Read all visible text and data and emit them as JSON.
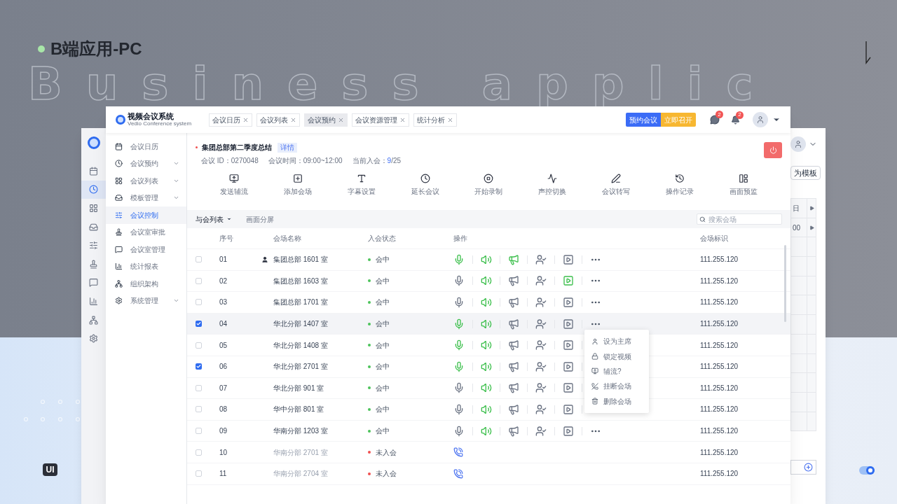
{
  "backdrop": {
    "heading": "B端应用-PC",
    "watermark": "Business applic",
    "badge": "UI"
  },
  "back_window": {
    "button": "为模板",
    "rail": [
      {
        "selected": false
      },
      {
        "selected": true
      },
      {
        "selected": false
      },
      {
        "selected": false
      },
      {
        "selected": false
      },
      {
        "selected": false
      },
      {
        "selected": false
      },
      {
        "selected": false
      },
      {
        "selected": false
      },
      {
        "selected": false
      }
    ],
    "cells": [
      "日",
      "00"
    ]
  },
  "app": {
    "title": "视频会议系统",
    "subtitle": "Vedio Conference system",
    "tabs": [
      {
        "label": "会议日历",
        "selected": false
      },
      {
        "label": "会议列表",
        "selected": false
      },
      {
        "label": "会议预约",
        "selected": true
      },
      {
        "label": "会议资源管理",
        "selected": false
      },
      {
        "label": "统计分析",
        "selected": false
      }
    ],
    "buttons": [
      "预约会议",
      "立即召开"
    ],
    "badges": [
      "2",
      "2"
    ],
    "sidebar": [
      {
        "label": "会议日历",
        "selected": false,
        "expandable": false
      },
      {
        "label": "会议预约",
        "selected": false,
        "expandable": true
      },
      {
        "label": "会议列表",
        "selected": false,
        "expandable": true
      },
      {
        "label": "模板管理",
        "selected": false,
        "expandable": true
      },
      {
        "label": "会议控制",
        "selected": true,
        "expandable": false
      },
      {
        "label": "会议室审批",
        "selected": false,
        "expandable": false
      },
      {
        "label": "会议室管理",
        "selected": false,
        "expandable": false
      },
      {
        "label": "统计报表",
        "selected": false,
        "expandable": false
      },
      {
        "label": "组织架构",
        "selected": false,
        "expandable": false
      },
      {
        "label": "系统管理",
        "selected": false,
        "expandable": true
      }
    ],
    "meeting": {
      "title": "集团总部第二季度总结",
      "tag": "详情",
      "id_label": "会议 ID：",
      "id": "0270048",
      "time_label": "会议时间：",
      "time": "09:00~12:00",
      "joined_label": "当前入会：",
      "joined": "9",
      "total": "/25"
    },
    "toolbar": [
      "发送辅流",
      "添加会场",
      "字幕设置",
      "延长会议",
      "开始录制",
      "声控切换",
      "会议转写",
      "操作记录",
      "画面预监"
    ],
    "views": [
      {
        "label": "与会列表",
        "selected": true
      },
      {
        "label": "画面分屏",
        "selected": false
      }
    ],
    "search": {
      "placeholder": "搜索会场"
    },
    "table": {
      "columns": [
        "序号",
        "会场名称",
        "入会状态",
        "操作",
        "会场标识"
      ],
      "rows": [
        {
          "checked": false,
          "selected": false,
          "index": "01",
          "more": true,
          "chair": true,
          "name": "集团总部 1601 室",
          "status": "会中",
          "kind": "joined",
          "mic_on": true,
          "speaker_on": true,
          "broadcast_on": true,
          "video_on": false,
          "id": "111.255.120"
        },
        {
          "checked": false,
          "selected": false,
          "index": "02",
          "more": true,
          "chair": false,
          "name": "集团总部 1603 室",
          "status": "会中",
          "kind": "joined",
          "mic_on": false,
          "speaker_on": true,
          "broadcast_on": false,
          "video_on": true,
          "id": "111.255.120"
        },
        {
          "checked": false,
          "selected": false,
          "index": "03",
          "more": true,
          "chair": false,
          "name": "集团总部 1701 室",
          "status": "会中",
          "kind": "joined",
          "mic_on": false,
          "speaker_on": true,
          "broadcast_on": false,
          "video_on": false,
          "id": "111.255.120"
        },
        {
          "checked": true,
          "selected": true,
          "index": "04",
          "more": true,
          "chair": false,
          "name": "华北分部 1407 室",
          "status": "会中",
          "kind": "joined",
          "mic_on": true,
          "speaker_on": true,
          "broadcast_on": false,
          "video_on": false,
          "id": "111.255.120"
        },
        {
          "checked": false,
          "selected": false,
          "index": "05",
          "more": false,
          "chair": false,
          "name": "华北分部 1408 室",
          "status": "会中",
          "kind": "joined",
          "mic_on": true,
          "speaker_on": true,
          "broadcast_on": false,
          "video_on": false,
          "id": "111.255.120"
        },
        {
          "checked": true,
          "selected": false,
          "index": "06",
          "more": false,
          "chair": false,
          "name": "华北分部 2701 室",
          "status": "会中",
          "kind": "joined",
          "mic_on": true,
          "speaker_on": true,
          "broadcast_on": false,
          "video_on": false,
          "id": "111.255.120"
        },
        {
          "checked": false,
          "selected": false,
          "index": "07",
          "more": false,
          "chair": false,
          "name": "华北分部 901 室",
          "status": "会中",
          "kind": "joined",
          "mic_on": false,
          "speaker_on": true,
          "broadcast_on": false,
          "video_on": false,
          "id": "111.255.120"
        },
        {
          "checked": false,
          "selected": false,
          "index": "08",
          "more": false,
          "chair": false,
          "name": "华中分部 801 室",
          "status": "会中",
          "kind": "joined",
          "mic_on": false,
          "speaker_on": true,
          "broadcast_on": false,
          "video_on": false,
          "id": "111.255.120"
        },
        {
          "checked": false,
          "selected": false,
          "index": "09",
          "more": true,
          "chair": false,
          "name": "华南分部 1203 室",
          "status": "会中",
          "kind": "joined",
          "mic_on": false,
          "speaker_on": true,
          "broadcast_on": false,
          "video_on": false,
          "id": "111.255.120"
        },
        {
          "checked": false,
          "selected": false,
          "index": "10",
          "chair": false,
          "name": "华南分部 2701 室",
          "status": "未入会",
          "kind": "absent",
          "id": "111.255.120"
        },
        {
          "checked": false,
          "selected": false,
          "index": "11",
          "chair": false,
          "name": "华南分部 2704 室",
          "status": "未入会",
          "kind": "absent",
          "id": "111.255.120"
        }
      ]
    },
    "menu": [
      "设为主席",
      "锁定视频",
      "辅流?",
      "挂断会场",
      "删除会场"
    ]
  }
}
